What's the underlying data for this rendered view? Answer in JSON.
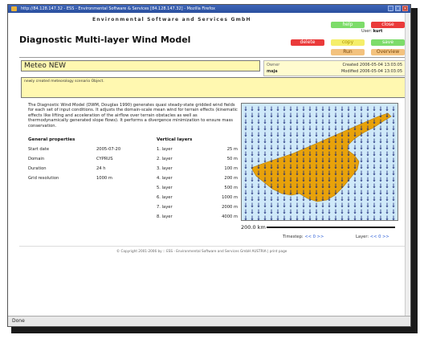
{
  "browser": {
    "title": "http://84.128.147.32 - ESS - Environmental Software & Services [84.128.147.32] - Mozilla Firefox",
    "status": "Done"
  },
  "header": {
    "company": "Environmental Software and Services GmbH",
    "app_title": "Diagnostic Multi-layer Wind Model",
    "user_label": "User:",
    "user_value": "kurt"
  },
  "buttons": {
    "help": "help",
    "close": "close",
    "delete": "delete",
    "copy": "copy",
    "save": "save",
    "run": "Run",
    "overview": "Overview"
  },
  "scenario": {
    "name": "Meteo NEW",
    "owner_label": "Owner",
    "owner": "maja",
    "created": "Created 2006-05-04 13:03:05",
    "modified": "Modified 2006-05-04 13:03:05",
    "description": "newly created meteorology scenario Object."
  },
  "intro": "The Diagnostic Wind Model (DWM, Douglas 1990) generates quasi steady-state gridded wind fields for each set of input conditions. It adjusts the domain-scale mean wind for terrain effects (kinematic effects like lifting and acceleration of the airflow over terrain obstacles as well as thermodynamically generated slope flows). It performs a divergence minimization to ensure mass conservation.",
  "general": {
    "heading": "General properties",
    "rows": [
      {
        "label": "Start date",
        "value": "2005-07-20"
      },
      {
        "label": "Domain",
        "value": "CYPRUS"
      },
      {
        "label": "Duration",
        "value": "24 h"
      },
      {
        "label": "Grid resolution",
        "value": "1000 m"
      }
    ]
  },
  "layers": {
    "heading": "Vertical layers",
    "rows": [
      {
        "label": "1. layer",
        "value": "25 m"
      },
      {
        "label": "2. layer",
        "value": "50 m"
      },
      {
        "label": "3. layer",
        "value": "100 m"
      },
      {
        "label": "4. layer",
        "value": "200 m"
      },
      {
        "label": "5. layer",
        "value": "500 m"
      },
      {
        "label": "6. layer",
        "value": "1000 m"
      },
      {
        "label": "7. layer",
        "value": "2000 m"
      },
      {
        "label": "8. layer",
        "value": "4000 m"
      }
    ]
  },
  "map": {
    "scale_label": "200.0 km",
    "timestep_label": "Timestep:",
    "timestep_value": "<< 0 >>",
    "layer_label": "Layer:",
    "layer_value": "<< 0 >>",
    "sea_color": "#cfe9f9",
    "land_color": "#e8a20a"
  },
  "footer": "© Copyright 2001-2006 by :: ESS - Environmental Software and Services GmbH AUSTRIA | print page"
}
